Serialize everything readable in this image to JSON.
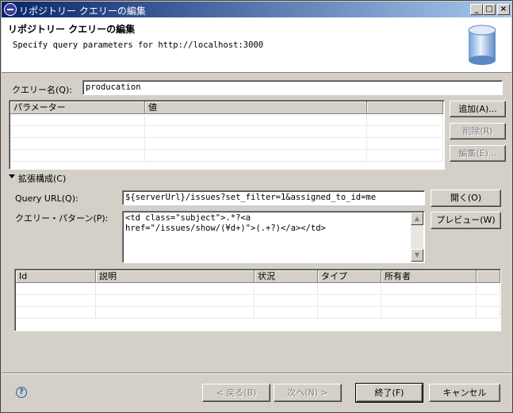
{
  "window": {
    "title": "リポジトリー クエリーの編集",
    "minimize": "_",
    "maximize": "□",
    "close": "×"
  },
  "header": {
    "title": "リポジトリー クエリーの編集",
    "description": "Specify query parameters for http://localhost:3000"
  },
  "query_name": {
    "label": "クエリー名(Q):",
    "value": "producation"
  },
  "parameters": {
    "columns": [
      "パラメーター",
      "値",
      ""
    ],
    "add_label": "追加(A)...",
    "remove_label": "削除(R)",
    "edit_label": "編集(E)..."
  },
  "advanced": {
    "section_label": "拡張構成(C)",
    "url_label": "Query URL(Q):",
    "url_value": "${serverUrl}/issues?set_filter=1&assigned_to_id=me",
    "open_label": "開く(O)",
    "pattern_label": "クエリー・パターン(P):",
    "pattern_value": "<td class=\"subject\">.*?<a\nhref=\"/issues/show/(¥d+)\">(.+?)</a></td>",
    "preview_label": "プレビュー(W)"
  },
  "results": {
    "columns": [
      "Id",
      "説明",
      "状況",
      "タイプ",
      "所有者",
      ""
    ]
  },
  "footer": {
    "help": "?",
    "back_label": "< 戻る(B)",
    "next_label": "次へ(N) >",
    "finish_label": "終了(F)",
    "cancel_label": "キャンセル"
  },
  "colors": {
    "title_gradient_start": "#0a246a",
    "title_gradient_end": "#a6caf0",
    "dialog_bg": "#d4d0c8"
  }
}
